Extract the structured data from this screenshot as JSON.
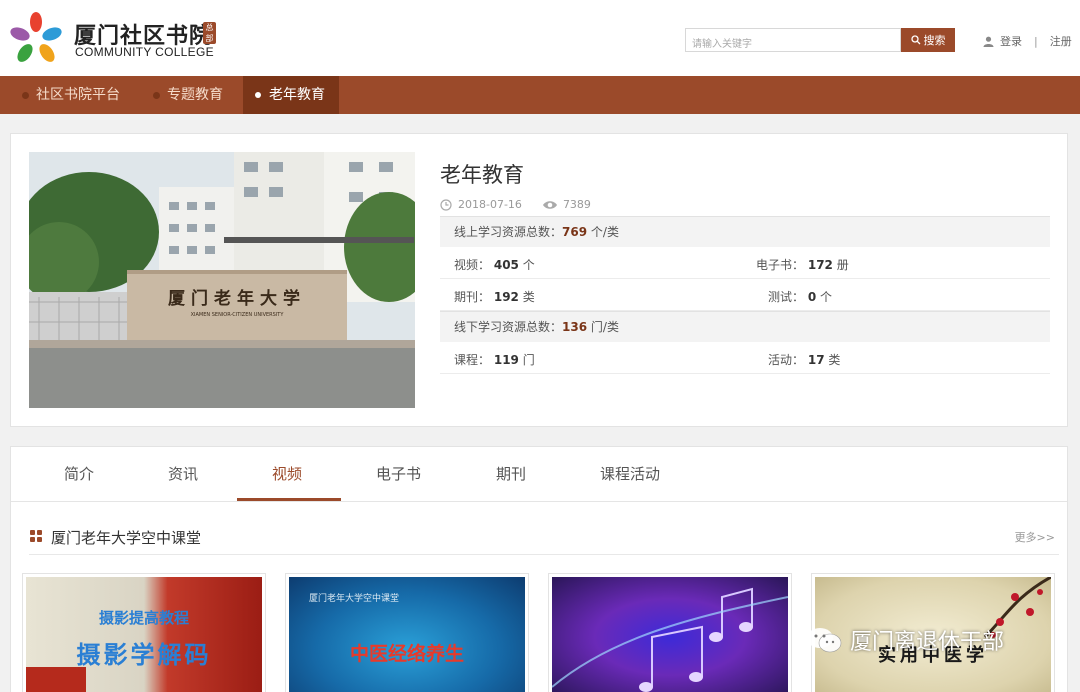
{
  "header": {
    "logo_cn": "厦门社区书院",
    "logo_badge": "总部",
    "logo_en": "COMMUNITY COLLEGE",
    "search_placeholder": "请输入关键字",
    "search_button": "搜索",
    "login": "登录",
    "separator": "|",
    "register": "注册"
  },
  "nav": {
    "items": [
      {
        "label": "社区书院平台"
      },
      {
        "label": "专题教育"
      },
      {
        "label": "老年教育",
        "active": true
      }
    ]
  },
  "info": {
    "title": "老年教育",
    "date": "2018-07-16",
    "views": "7389",
    "photo_sign": "厦门老年大学",
    "photo_sign_en": "XIAMEN SENIOR-CITIZEN UNIVERSITY",
    "online": {
      "label": "线上学习资源总数：",
      "value": "769",
      "unit": "个/类"
    },
    "rows1": [
      {
        "l_label": "视频：",
        "l_value": "405",
        "l_unit": "个",
        "r_label": "电子书：",
        "r_value": "172",
        "r_unit": "册"
      },
      {
        "l_label": "期刊：",
        "l_value": "192",
        "l_unit": "类",
        "r_label": "测试：",
        "r_value": "0",
        "r_unit": "个"
      }
    ],
    "offline": {
      "label": "线下学习资源总数：",
      "value": "136",
      "unit": "门/类"
    },
    "rows2": [
      {
        "l_label": "课程：",
        "l_value": "119",
        "l_unit": "门",
        "r_label": "活动：",
        "r_value": "17",
        "r_unit": "类"
      }
    ]
  },
  "tabs": {
    "items": [
      "简介",
      "资讯",
      "视频",
      "电子书",
      "期刊",
      "课程活动"
    ],
    "active": "视频"
  },
  "section": {
    "title": "厦门老年大学空中课堂",
    "more": "更多>>"
  },
  "thumbs": [
    {
      "caption_top": "摄影提高教程",
      "caption_main": "摄影学解码"
    },
    {
      "caption_top": "厦门老年大学空中课堂",
      "caption_main": "中医经络养生"
    },
    {
      "caption_top": "",
      "caption_main": ""
    },
    {
      "caption_top": "",
      "caption_main": "实用中医学"
    }
  ],
  "watermark": "厦门离退休干部",
  "colors": {
    "brand": "#9b4a2a",
    "brand_dark": "#7a3518"
  }
}
